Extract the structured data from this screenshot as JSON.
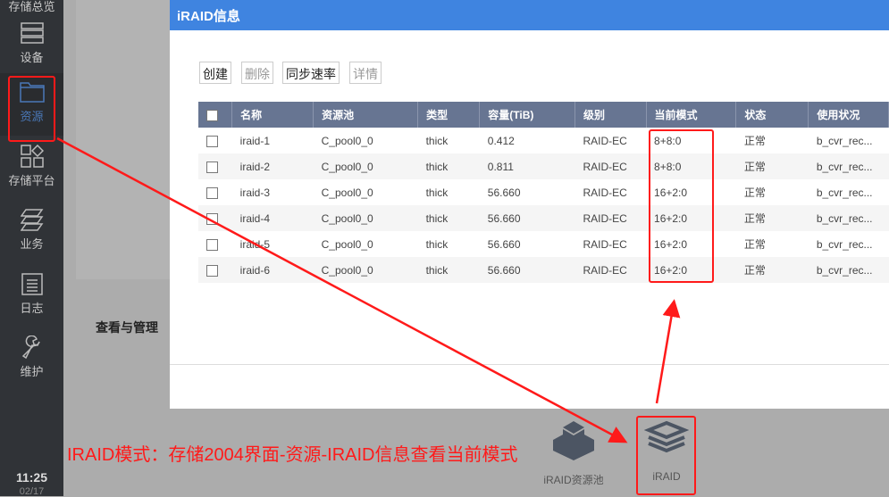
{
  "sidebar": {
    "items": [
      {
        "label": "存储总览"
      },
      {
        "label": "设备"
      },
      {
        "label": "资源"
      },
      {
        "label": "存储平台"
      },
      {
        "label": "业务"
      },
      {
        "label": "日志"
      },
      {
        "label": "维护"
      }
    ],
    "time": "11:25",
    "date": "02/17"
  },
  "background": {
    "manage_label": "查看与管理"
  },
  "dialog": {
    "title": "iRAID信息",
    "buttons": {
      "create": "创建",
      "delete": "删除",
      "sync_rate": "同步速率",
      "details": "详情"
    },
    "columns": [
      "名称",
      "资源池",
      "类型",
      "容量(TiB)",
      "级别",
      "当前模式",
      "状态",
      "使用状况"
    ],
    "rows": [
      [
        "iraid-1",
        "C_pool0_0",
        "thick",
        "0.412",
        "RAID-EC",
        "8+8:0",
        "正常",
        "b_cvr_rec..."
      ],
      [
        "iraid-2",
        "C_pool0_0",
        "thick",
        "0.811",
        "RAID-EC",
        "8+8:0",
        "正常",
        "b_cvr_rec..."
      ],
      [
        "iraid-3",
        "C_pool0_0",
        "thick",
        "56.660",
        "RAID-EC",
        "16+2:0",
        "正常",
        "b_cvr_rec..."
      ],
      [
        "iraid-4",
        "C_pool0_0",
        "thick",
        "56.660",
        "RAID-EC",
        "16+2:0",
        "正常",
        "b_cvr_rec..."
      ],
      [
        "iraid-5",
        "C_pool0_0",
        "thick",
        "56.660",
        "RAID-EC",
        "16+2:0",
        "正常",
        "b_cvr_rec..."
      ],
      [
        "iraid-6",
        "C_pool0_0",
        "thick",
        "56.660",
        "RAID-EC",
        "16+2:0",
        "正常",
        "b_cvr_rec..."
      ]
    ]
  },
  "bottom": {
    "pool_label": "iRAID资源池",
    "iraid_label": "iRAID"
  },
  "annotation": {
    "note": "IRAID模式：存储2004界面-资源-IRAID信息查看当前模式",
    "color": "#ff1a1a"
  }
}
